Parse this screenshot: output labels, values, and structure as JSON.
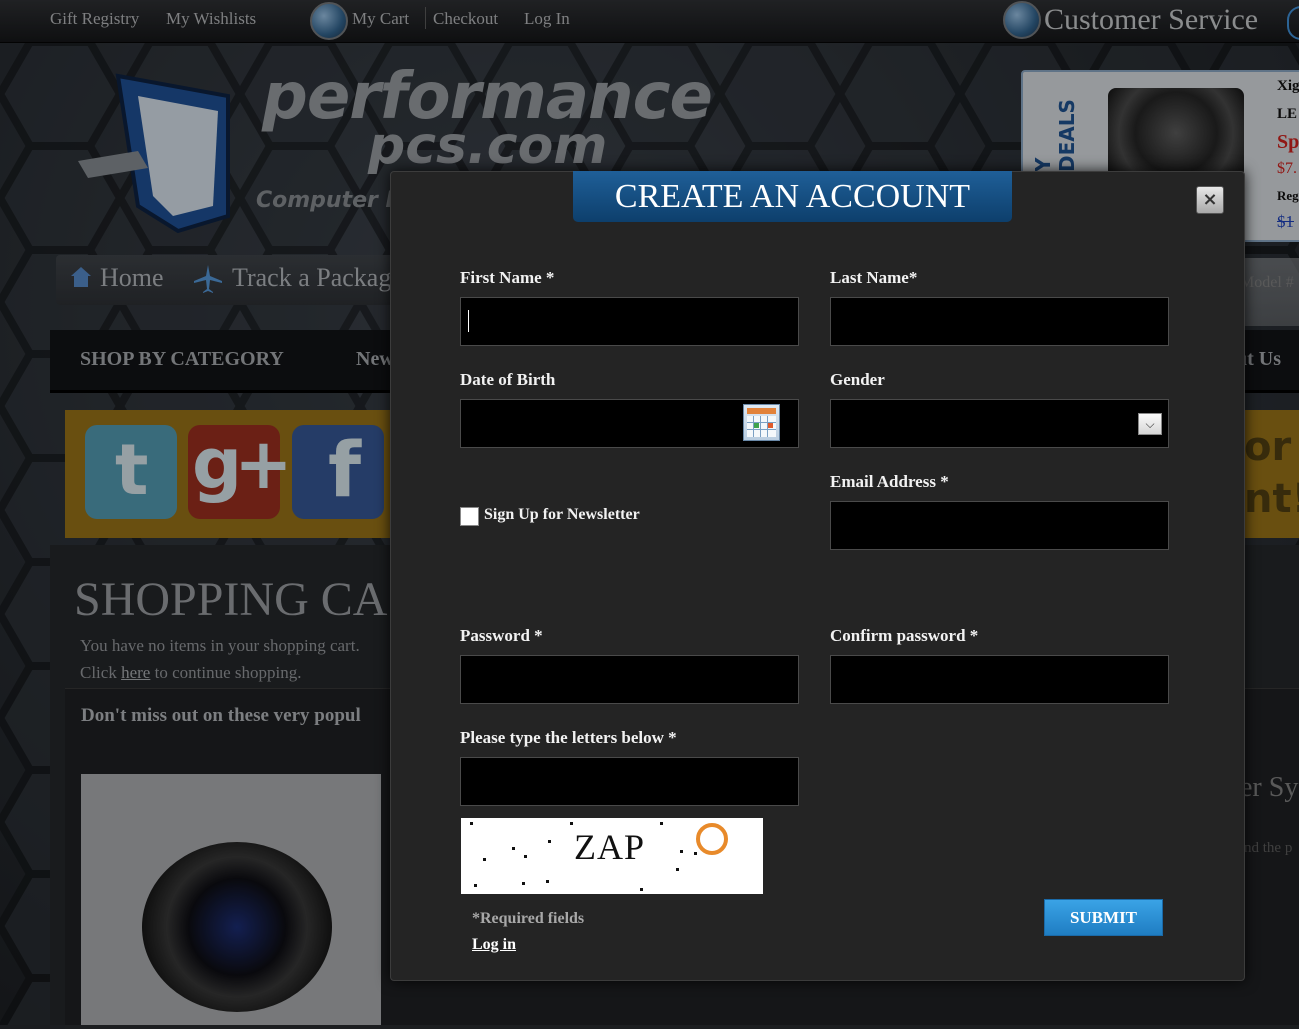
{
  "topbar": {
    "gift_registry": "Gift Registry",
    "my_wishlists": "My Wishlists",
    "my_cart": "My Cart",
    "checkout": "Checkout",
    "log_in": "Log In",
    "customer_service": "Customer Service"
  },
  "logo": {
    "line1": "performance",
    "line2": "pcs.com",
    "line3": "Computer M"
  },
  "deals": {
    "vertical_label": "Y DEALS",
    "line1": "Xig",
    "line2": "LE",
    "line3": "Sp",
    "line4": "$7.",
    "line5": "Reg",
    "line6": "$1"
  },
  "nav": {
    "home": "Home",
    "track": "Track a Packag",
    "model": "Model #"
  },
  "category_bar": {
    "shop_by_category": "SHOP BY CATEGORY",
    "new": "New",
    "about": "ut Us"
  },
  "social": {
    "twitter": "t",
    "google": "g+",
    "facebook": "f",
    "right_line1": "or",
    "right_line2": "nt!"
  },
  "cart": {
    "title": "SHOPPING CA",
    "empty_message": "You have no items in your shopping cart.",
    "click_prefix": "Click ",
    "here": "here",
    "click_suffix": " to continue shopping.",
    "popular_title": "Don't miss out on these very popul",
    "right_text1": "er Sy",
    "right_text2": "nd the p"
  },
  "modal": {
    "title": "CREATE AN ACCOUNT",
    "close": "×",
    "first_name_label": "First Name *",
    "last_name_label": "Last Name*",
    "dob_label": "Date of Birth",
    "gender_label": "Gender",
    "email_label": "Email Address *",
    "newsletter_label": "Sign Up for Newsletter",
    "password_label": "Password *",
    "confirm_password_label": "Confirm password *",
    "captcha_label": "Please type the letters below *",
    "captcha_text": "ZAP",
    "required_note": "*Required fields",
    "login_link": "Log in",
    "submit": "SUBMIT",
    "first_name_value": "",
    "last_name_value": "",
    "dob_value": "",
    "gender_value": "",
    "email_value": "",
    "password_value": "",
    "confirm_password_value": "",
    "captcha_value": ""
  },
  "colors": {
    "modal_bg": "#242424",
    "title_tab": "#0d3f6c",
    "submit_button": "#2a8fd6",
    "input_bg": "#000000"
  }
}
